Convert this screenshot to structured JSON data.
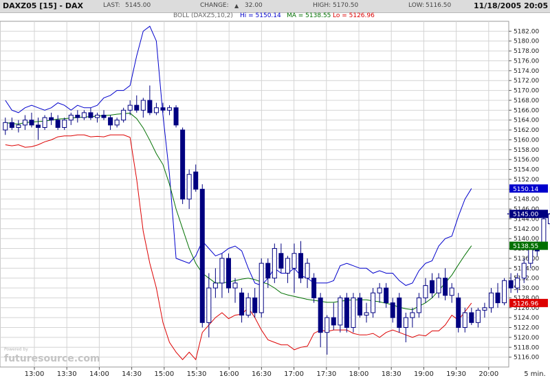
{
  "header": {
    "symbol": "DAXZ05 [15] - DAX",
    "last_label": "LAST:",
    "last_value": "5145.00",
    "change_label": "CHANGE:",
    "change_arrow": "▲",
    "change_value": "32.00",
    "high_label": "HIGH:",
    "high_value": "5170.50",
    "low_label": "LOW:",
    "low_value": "5116.50",
    "datetime": "11/18/2005 20:05"
  },
  "indicator": {
    "prefix": "BOLL (DAXZ5,10,2)",
    "hi_text": "Hi = 5150.14",
    "ma_text": "MA = 5138.55",
    "lo_text": "Lo = 5126.96"
  },
  "watermark": {
    "powered": "Powered by",
    "brand": "futuresource.com"
  },
  "colors": {
    "hi": "#0000cc",
    "ma": "#007000",
    "lo": "#dd0000",
    "candle_down": "#000080",
    "candle_up": "#ffffff",
    "last_tag": "#000080",
    "grid": "#d4d4d4"
  },
  "chart_data": {
    "type": "candlestick",
    "interval": "15 min",
    "x_tick_labels": [
      "13:00",
      "13:30",
      "14:00",
      "14:30",
      "15:00",
      "15:30",
      "16:00",
      "16:30",
      "17:00",
      "17:30",
      "18:00",
      "18:30",
      "19:00",
      "19:30",
      "20:00"
    ],
    "x_unit_label": "5 min.",
    "y_tick_labels": [
      "5116.00",
      "5118.00",
      "5120.00",
      "5122.00",
      "5124.00",
      "5126.00",
      "5128.00",
      "5130.00",
      "5132.00",
      "5134.00",
      "5136.00",
      "5138.00",
      "5140.00",
      "5142.00",
      "5144.00",
      "5146.00",
      "5148.00",
      "5150.00",
      "5152.00",
      "5154.00",
      "5156.00",
      "5158.00",
      "5160.00",
      "5162.00",
      "5164.00",
      "5166.00",
      "5168.00",
      "5170.00",
      "5172.00",
      "5174.00",
      "5176.00",
      "5178.00",
      "5180.00",
      "5182.00"
    ],
    "ylim": [
      5114,
      5184
    ],
    "last_value_tags": [
      {
        "label": "5150.14",
        "value": 5150.14,
        "color": "#0000cc"
      },
      {
        "label": "5145.00",
        "value": 5145.0,
        "color": "#000080"
      },
      {
        "label": "5138.55",
        "value": 5138.55,
        "color": "#007000"
      },
      {
        "label": "5126.96",
        "value": 5126.96,
        "color": "#dd0000"
      }
    ],
    "candles": [
      {
        "o": 5162.0,
        "h": 5164.5,
        "l": 5161.0,
        "c": 5163.5
      },
      {
        "o": 5163.5,
        "h": 5164.5,
        "l": 5162.0,
        "c": 5162.5
      },
      {
        "o": 5162.5,
        "h": 5164.0,
        "l": 5161.5,
        "c": 5163.0
      },
      {
        "o": 5163.0,
        "h": 5165.0,
        "l": 5162.0,
        "c": 5164.0
      },
      {
        "o": 5164.0,
        "h": 5165.5,
        "l": 5162.5,
        "c": 5163.0
      },
      {
        "o": 5163.0,
        "h": 5164.5,
        "l": 5160.0,
        "c": 5162.5
      },
      {
        "o": 5162.5,
        "h": 5165.0,
        "l": 5162.0,
        "c": 5164.5
      },
      {
        "o": 5164.5,
        "h": 5165.5,
        "l": 5163.0,
        "c": 5164.0
      },
      {
        "o": 5164.0,
        "h": 5165.0,
        "l": 5162.0,
        "c": 5162.5
      },
      {
        "o": 5162.5,
        "h": 5164.5,
        "l": 5162.0,
        "c": 5164.0
      },
      {
        "o": 5164.0,
        "h": 5165.5,
        "l": 5163.0,
        "c": 5165.0
      },
      {
        "o": 5165.0,
        "h": 5166.0,
        "l": 5163.5,
        "c": 5164.5
      },
      {
        "o": 5164.5,
        "h": 5166.0,
        "l": 5164.0,
        "c": 5165.5
      },
      {
        "o": 5165.5,
        "h": 5166.5,
        "l": 5164.0,
        "c": 5164.5
      },
      {
        "o": 5164.5,
        "h": 5165.5,
        "l": 5163.5,
        "c": 5165.0
      },
      {
        "o": 5165.0,
        "h": 5166.0,
        "l": 5164.0,
        "c": 5164.5
      },
      {
        "o": 5164.5,
        "h": 5165.0,
        "l": 5162.0,
        "c": 5163.0
      },
      {
        "o": 5163.0,
        "h": 5164.5,
        "l": 5162.5,
        "c": 5164.0
      },
      {
        "o": 5164.0,
        "h": 5166.5,
        "l": 5163.5,
        "c": 5166.0
      },
      {
        "o": 5166.0,
        "h": 5168.0,
        "l": 5165.0,
        "c": 5167.0
      },
      {
        "o": 5167.0,
        "h": 5169.0,
        "l": 5165.5,
        "c": 5166.0
      },
      {
        "o": 5166.0,
        "h": 5168.5,
        "l": 5164.5,
        "c": 5168.0
      },
      {
        "o": 5168.0,
        "h": 5171.0,
        "l": 5165.0,
        "c": 5165.5
      },
      {
        "o": 5165.5,
        "h": 5167.5,
        "l": 5165.0,
        "c": 5166.5
      },
      {
        "o": 5166.5,
        "h": 5167.5,
        "l": 5165.5,
        "c": 5166.0
      },
      {
        "o": 5166.0,
        "h": 5167.0,
        "l": 5165.0,
        "c": 5166.5
      },
      {
        "o": 5166.5,
        "h": 5167.0,
        "l": 5162.5,
        "c": 5163.0
      },
      {
        "o": 5162.0,
        "h": 5162.5,
        "l": 5147.0,
        "c": 5148.0
      },
      {
        "o": 5148.0,
        "h": 5154.0,
        "l": 5146.0,
        "c": 5153.0
      },
      {
        "o": 5153.5,
        "h": 5155.0,
        "l": 5149.5,
        "c": 5150.0
      },
      {
        "o": 5150.0,
        "h": 5151.0,
        "l": 5122.0,
        "c": 5123.0
      },
      {
        "o": 5123.0,
        "h": 5133.0,
        "l": 5120.0,
        "c": 5130.0
      },
      {
        "o": 5130.0,
        "h": 5134.0,
        "l": 5128.0,
        "c": 5131.0
      },
      {
        "o": 5131.0,
        "h": 5137.0,
        "l": 5128.0,
        "c": 5136.0
      },
      {
        "o": 5136.0,
        "h": 5137.0,
        "l": 5129.0,
        "c": 5130.0
      },
      {
        "o": 5130.0,
        "h": 5132.0,
        "l": 5127.0,
        "c": 5131.0
      },
      {
        "o": 5129.0,
        "h": 5130.0,
        "l": 5123.0,
        "c": 5124.5
      },
      {
        "o": 5124.5,
        "h": 5129.0,
        "l": 5124.0,
        "c": 5128.0
      },
      {
        "o": 5128.0,
        "h": 5130.0,
        "l": 5124.0,
        "c": 5125.0
      },
      {
        "o": 5125.0,
        "h": 5136.0,
        "l": 5124.0,
        "c": 5135.0
      },
      {
        "o": 5135.0,
        "h": 5136.0,
        "l": 5130.0,
        "c": 5132.0
      },
      {
        "o": 5132.0,
        "h": 5139.0,
        "l": 5131.0,
        "c": 5138.0
      },
      {
        "o": 5137.0,
        "h": 5139.0,
        "l": 5133.0,
        "c": 5134.0
      },
      {
        "o": 5133.0,
        "h": 5136.5,
        "l": 5131.0,
        "c": 5136.0
      },
      {
        "o": 5134.0,
        "h": 5139.0,
        "l": 5129.0,
        "c": 5137.0
      },
      {
        "o": 5137.0,
        "h": 5139.5,
        "l": 5131.0,
        "c": 5132.0
      },
      {
        "o": 5132.0,
        "h": 5136.0,
        "l": 5130.0,
        "c": 5135.0
      },
      {
        "o": 5132.0,
        "h": 5133.0,
        "l": 5127.0,
        "c": 5128.0
      },
      {
        "o": 5128.0,
        "h": 5129.0,
        "l": 5118.0,
        "c": 5121.0
      },
      {
        "o": 5121.0,
        "h": 5124.5,
        "l": 5116.5,
        "c": 5124.0
      },
      {
        "o": 5124.0,
        "h": 5127.0,
        "l": 5121.5,
        "c": 5122.5
      },
      {
        "o": 5122.5,
        "h": 5128.5,
        "l": 5121.0,
        "c": 5128.0
      },
      {
        "o": 5128.0,
        "h": 5129.0,
        "l": 5121.0,
        "c": 5122.0
      },
      {
        "o": 5122.0,
        "h": 5129.0,
        "l": 5121.0,
        "c": 5128.0
      },
      {
        "o": 5128.0,
        "h": 5129.0,
        "l": 5124.0,
        "c": 5124.5
      },
      {
        "o": 5124.5,
        "h": 5127.0,
        "l": 5123.0,
        "c": 5125.0
      },
      {
        "o": 5125.0,
        "h": 5130.0,
        "l": 5124.0,
        "c": 5129.0
      },
      {
        "o": 5129.0,
        "h": 5131.0,
        "l": 5127.0,
        "c": 5130.0
      },
      {
        "o": 5130.0,
        "h": 5131.0,
        "l": 5126.0,
        "c": 5127.0
      },
      {
        "o": 5127.0,
        "h": 5128.0,
        "l": 5123.0,
        "c": 5124.0
      },
      {
        "o": 5128.0,
        "h": 5129.0,
        "l": 5121.0,
        "c": 5122.0
      },
      {
        "o": 5122.0,
        "h": 5125.0,
        "l": 5119.0,
        "c": 5124.0
      },
      {
        "o": 5124.0,
        "h": 5126.0,
        "l": 5122.0,
        "c": 5125.0
      },
      {
        "o": 5125.0,
        "h": 5129.0,
        "l": 5124.0,
        "c": 5128.0
      },
      {
        "o": 5128.0,
        "h": 5132.0,
        "l": 5127.0,
        "c": 5130.5
      },
      {
        "o": 5131.5,
        "h": 5133.0,
        "l": 5128.0,
        "c": 5129.0
      },
      {
        "o": 5129.0,
        "h": 5133.0,
        "l": 5128.0,
        "c": 5132.0
      },
      {
        "o": 5132.0,
        "h": 5134.0,
        "l": 5127.5,
        "c": 5128.5
      },
      {
        "o": 5128.5,
        "h": 5131.0,
        "l": 5127.0,
        "c": 5130.0
      },
      {
        "o": 5128.0,
        "h": 5129.0,
        "l": 5121.0,
        "c": 5122.0
      },
      {
        "o": 5122.0,
        "h": 5126.0,
        "l": 5121.0,
        "c": 5125.0
      },
      {
        "o": 5125.0,
        "h": 5126.0,
        "l": 5122.5,
        "c": 5123.0
      },
      {
        "o": 5123.0,
        "h": 5126.0,
        "l": 5122.0,
        "c": 5125.5
      },
      {
        "o": 5125.5,
        "h": 5127.0,
        "l": 5124.0,
        "c": 5126.0
      },
      {
        "o": 5126.0,
        "h": 5130.0,
        "l": 5125.0,
        "c": 5129.0
      },
      {
        "o": 5129.0,
        "h": 5131.0,
        "l": 5126.0,
        "c": 5127.0
      },
      {
        "o": 5127.0,
        "h": 5132.0,
        "l": 5126.5,
        "c": 5131.5
      },
      {
        "o": 5131.5,
        "h": 5133.0,
        "l": 5129.0,
        "c": 5130.0
      },
      {
        "o": 5130.0,
        "h": 5133.0,
        "l": 5129.0,
        "c": 5132.0
      },
      {
        "o": 5132.0,
        "h": 5136.0,
        "l": 5131.0,
        "c": 5135.0
      },
      {
        "o": 5135.0,
        "h": 5139.0,
        "l": 5134.0,
        "c": 5138.0
      },
      {
        "o": 5138.0,
        "h": 5139.5,
        "l": 5136.5,
        "c": 5137.5
      },
      {
        "o": 5139.0,
        "h": 5144.5,
        "l": 5138.0,
        "c": 5144.0
      },
      {
        "o": 5143.0,
        "h": 5150.5,
        "l": 5142.0,
        "c": 5145.0
      }
    ],
    "boll_hi": [
      5168,
      5166,
      5165.5,
      5166.5,
      5167,
      5166.5,
      5166,
      5166.5,
      5167.5,
      5167,
      5166,
      5167,
      5166.5,
      5166.5,
      5167,
      5168.5,
      5169,
      5170,
      5170,
      5171,
      5177,
      5182,
      5183,
      5180,
      5165,
      5153,
      5136,
      5135.5,
      5135,
      5136.5,
      5139.5,
      5138,
      5136.5,
      5137,
      5138,
      5138.5,
      5137.5,
      5134,
      5131,
      5130.5,
      5132,
      5134,
      5133,
      5133,
      5134,
      5132.5,
      5132,
      5131,
      5131,
      5131,
      5131.5,
      5134.5,
      5135,
      5134.5,
      5134,
      5134,
      5133,
      5133.5,
      5133,
      5133,
      5131.5,
      5130.5,
      5131,
      5133.5,
      5135,
      5135.5,
      5138.5,
      5140,
      5140.5,
      5144.5,
      5148,
      5150.14
    ],
    "boll_ma": [
      5163.5,
      5163.3,
      5163.2,
      5163.5,
      5163.6,
      5163.7,
      5163.8,
      5164,
      5164.2,
      5164.3,
      5164.4,
      5164.5,
      5164.6,
      5164.7,
      5164.8,
      5164.9,
      5165,
      5165.2,
      5165.3,
      5165.4,
      5164.3,
      5162.4,
      5159.9,
      5157.2,
      5155,
      5151,
      5146,
      5142,
      5138,
      5135,
      5133,
      5132,
      5131,
      5131,
      5131.2,
      5131.5,
      5131.8,
      5132,
      5131.7,
      5131.2,
      5130.8,
      5130,
      5129,
      5128.6,
      5128.3,
      5128,
      5127.7,
      5127.5,
      5127.3,
      5127.1,
      5127.1,
      5127.3,
      5127.5,
      5127.6,
      5127.6,
      5127.6,
      5127.4,
      5127.2,
      5126.9,
      5126.6,
      5126.1,
      5125.8,
      5125.6,
      5126.3,
      5127,
      5128,
      5129.5,
      5131,
      5132.6,
      5134.7,
      5136.7,
      5138.55
    ],
    "boll_lo": [
      5159,
      5158.8,
      5159,
      5158.5,
      5158.6,
      5159,
      5159.6,
      5160,
      5160.6,
      5160.8,
      5160.8,
      5161,
      5161,
      5160.6,
      5160.7,
      5160.6,
      5161,
      5161,
      5161,
      5160.5,
      5152,
      5141.5,
      5135,
      5130,
      5123,
      5119,
      5117,
      5115.5,
      5117,
      5115.5,
      5121,
      5122.5,
      5124,
      5125,
      5123.8,
      5124.5,
      5124.7,
      5126,
      5124,
      5121.5,
      5119.5,
      5119,
      5118.5,
      5118.5,
      5117.5,
      5118,
      5118.2,
      5120.8,
      5121.5,
      5121.2,
      5121.5,
      5121.5,
      5121.5,
      5120.8,
      5120.5,
      5120.5,
      5120.8,
      5120,
      5121,
      5121.5,
      5121,
      5120.5,
      5120,
      5120.5,
      5120.3,
      5121.3,
      5121.3,
      5122.5,
      5124.5,
      5123.5,
      5125.2,
      5126.96
    ]
  }
}
